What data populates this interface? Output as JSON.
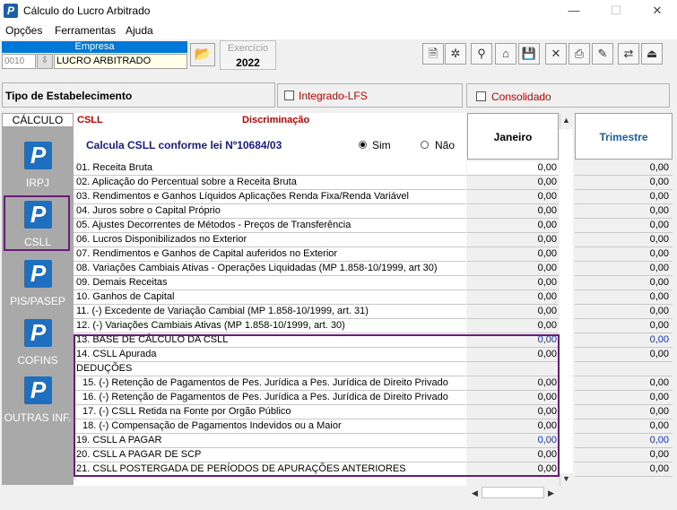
{
  "window": {
    "title": "Cálculo do Lucro Arbitrado",
    "icon": "p-logo",
    "minimize": "—",
    "maximize": "☐",
    "close": "✕"
  },
  "menu": [
    "Opções",
    "Ferramentas",
    "Ajuda"
  ],
  "empresa": {
    "label": "Empresa",
    "code": "0010",
    "name": "LUCRO ARBITRADO"
  },
  "exercicio": {
    "label": "Exercício",
    "value": "2022"
  },
  "toolbar": [
    {
      "name": "new-document-icon",
      "glyph": "🗎"
    },
    {
      "name": "settings-icon",
      "glyph": "✲"
    },
    {
      "name": "search-icon",
      "glyph": "⚲"
    },
    {
      "name": "tool-icon",
      "glyph": "⌂"
    },
    {
      "name": "save-icon",
      "glyph": "💾"
    },
    {
      "name": "delete-icon",
      "glyph": "✕"
    },
    {
      "name": "print-icon",
      "glyph": "⎙"
    },
    {
      "name": "edit-icon",
      "glyph": "✎"
    },
    {
      "name": "transfer-icon",
      "glyph": "⇄"
    },
    {
      "name": "exit-icon",
      "glyph": "⏏"
    }
  ],
  "tipo": {
    "label": "Tipo de Estabelecimento",
    "integrado": "Integrado-LFS",
    "consolidado": "Consolidado"
  },
  "nav": {
    "header": "CÁLCULO",
    "items": [
      "IRPJ",
      "CSLL",
      "PIS/PASEP",
      "COFINS",
      "OUTRAS INF."
    ],
    "selected": "CSLL"
  },
  "grid": {
    "section": "CSLL",
    "column_title": "Discriminação",
    "calcula_text": "Calcula CSLL conforme lei  Nº10684/03",
    "radio_sim": "Sim",
    "radio_nao": "Não",
    "radio_selected": "Sim",
    "month_header": "Janeiro",
    "quarter_header": "Trimestre",
    "rows": [
      {
        "label": "01. Receita Bruta",
        "jan": "0,00",
        "tri": "0,00"
      },
      {
        "label": "02. Aplicação do Percentual sobre a Receita Bruta",
        "jan": "0,00",
        "tri": "0,00"
      },
      {
        "label": "03. Rendimentos e Ganhos Líquidos Aplicações Renda Fixa/Renda Variável",
        "jan": "0,00",
        "tri": "0,00"
      },
      {
        "label": "04. Juros sobre o Capital Próprio",
        "jan": "0,00",
        "tri": "0,00"
      },
      {
        "label": "05. Ajustes Decorrentes de Métodos - Preços de Transferência",
        "jan": "0,00",
        "tri": "0,00"
      },
      {
        "label": "06. Lucros Disponibilizados no Exterior",
        "jan": "0,00",
        "tri": "0,00"
      },
      {
        "label": "07. Rendimentos e Ganhos de Capital auferidos no Exterior",
        "jan": "0,00",
        "tri": "0,00"
      },
      {
        "label": "08. Variações Cambiais Ativas - Operações Liquidadas (MP 1.858-10/1999, art 30)",
        "jan": "0,00",
        "tri": "0,00"
      },
      {
        "label": "09. Demais Receitas",
        "jan": "0,00",
        "tri": "0,00"
      },
      {
        "label": "10. Ganhos de Capital",
        "jan": "0,00",
        "tri": "0,00"
      },
      {
        "label": "11. (-) Excedente de Variação Cambial (MP 1.858-10/1999, art. 31)",
        "jan": "0,00",
        "tri": "0,00"
      },
      {
        "label": "12. (-) Variações Cambiais Ativas (MP 1.858-10/1999, art. 30)",
        "jan": "0,00",
        "tri": "0,00"
      },
      {
        "label": "13. BASE DE CÁLCULO DA CSLL",
        "jan": "0,00",
        "tri": "0,00",
        "blue": true
      },
      {
        "label": "14. CSLL Apurada",
        "jan": "0,00",
        "tri": "0,00"
      },
      {
        "label": "DEDUÇÕES",
        "jan": "",
        "tri": ""
      },
      {
        "label": "15. (-) Retenção de Pagamentos de Pes. Jurídica a Pes. Jurídica de Direito Privado",
        "jan": "0,00",
        "tri": "0,00",
        "sub": true
      },
      {
        "label": "16. (-) Retenção de Pagamentos de Pes. Jurídica a Pes. Jurídica de Direito Privado",
        "jan": "0,00",
        "tri": "0,00",
        "sub": true
      },
      {
        "label": "17. (-) CSLL Retida na Fonte por Orgão Público",
        "jan": "0,00",
        "tri": "0,00",
        "sub": true
      },
      {
        "label": "18. (-) Compensação de Pagamentos Indevidos ou a Maior",
        "jan": "0,00",
        "tri": "0,00",
        "sub": true
      },
      {
        "label": "19. CSLL A PAGAR",
        "jan": "0,00",
        "tri": "0,00",
        "blue": true
      },
      {
        "label": "20. CSLL A PAGAR DE SCP",
        "jan": "0,00",
        "tri": "0,00"
      },
      {
        "label": "21. CSLL POSTERGADA DE PERÍODOS DE APURAÇÕES ANTERIORES",
        "jan": "0,00",
        "tri": "0,00"
      }
    ]
  },
  "colors": {
    "accent": "#0078d7",
    "highlight_border": "#6a1b7a",
    "red_label": "#c00000",
    "blue_value": "#1030c0",
    "nav_bg": "#a9a9a9"
  }
}
